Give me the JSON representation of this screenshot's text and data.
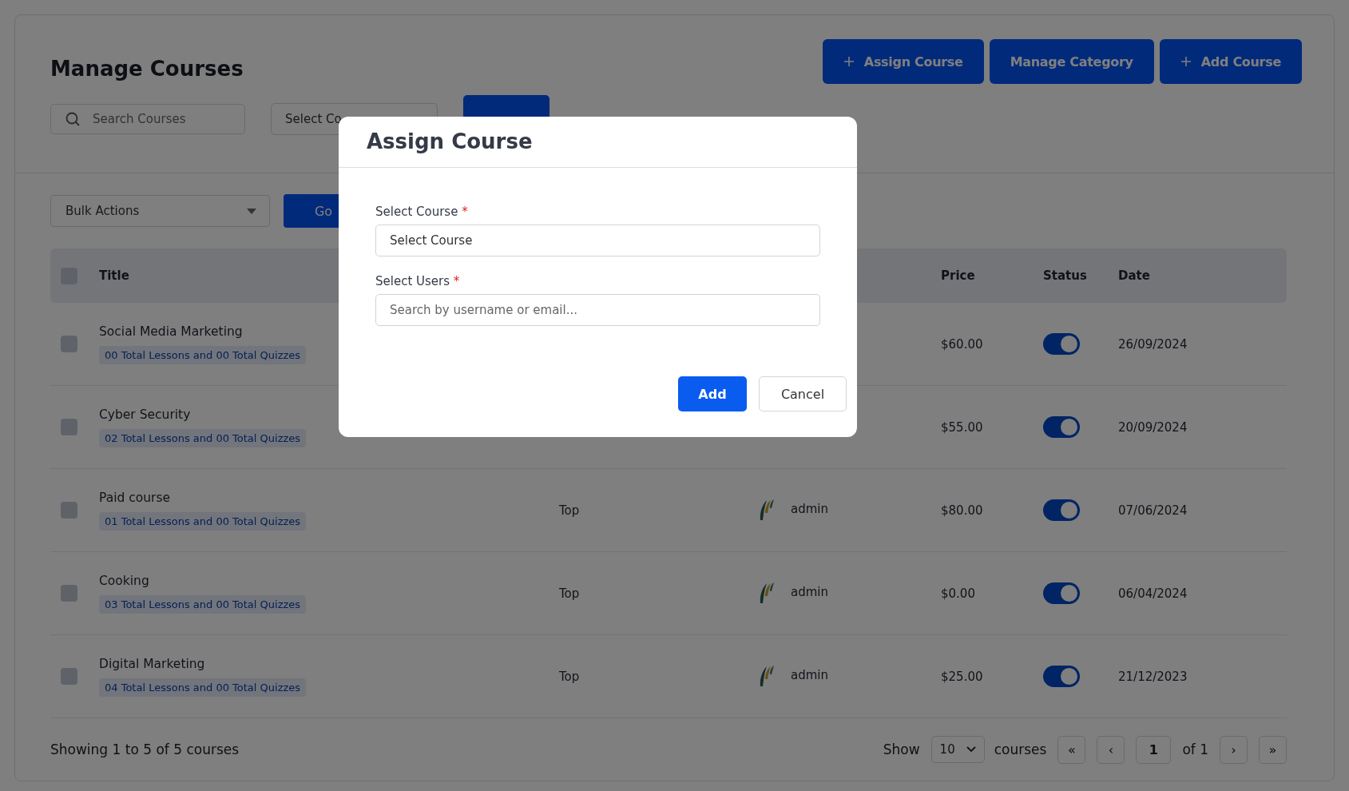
{
  "page": {
    "title": "Manage Courses",
    "actions": [
      {
        "label": "Assign Course",
        "kind": "add"
      },
      {
        "label": "Manage Category",
        "kind": "plain"
      },
      {
        "label": "Add Course",
        "kind": "add"
      }
    ],
    "filters": {
      "search": {
        "placeholder": "Search Courses"
      },
      "category_select": {
        "value": "Select Co"
      }
    },
    "bulk_actions": {
      "value": "Bulk Actions"
    },
    "go_button": "Go",
    "table": {
      "header_checkbox": {
        "checked": false
      },
      "columns": [
        {
          "label": "Title",
          "kind": "title"
        },
        {
          "label": "Price",
          "kind": "price"
        },
        {
          "label": "Status",
          "kind": "status"
        },
        {
          "label": "Date",
          "kind": "date"
        }
      ],
      "rows": [
        {
          "checked": false,
          "title": "Social Media Marketing",
          "summary": "00 Total Lessons and 00 Total Quizzes",
          "price": "$60.00",
          "on": true,
          "date": "26/09/2024"
        },
        {
          "checked": false,
          "title": "Cyber Security",
          "summary": "02 Total Lessons and 00 Total Quizzes",
          "price": "$55.00",
          "on": true,
          "date": "20/09/2024"
        },
        {
          "checked": false,
          "title": "Paid course",
          "summary": "01 Total Lessons and 00 Total Quizzes",
          "category": "Top",
          "author": "admin",
          "price": "$80.00",
          "on": true,
          "date": "07/06/2024"
        },
        {
          "checked": false,
          "title": "Cooking",
          "summary": "03 Total Lessons and 00 Total Quizzes",
          "category": "Top",
          "author": "admin",
          "price": "$0.00",
          "on": true,
          "date": "06/04/2024"
        },
        {
          "checked": false,
          "title": "Digital Marketing",
          "summary": "04 Total Lessons and 00 Total Quizzes",
          "category": "Top",
          "author": "admin",
          "price": "$25.00",
          "on": true,
          "date": "21/12/2023"
        }
      ]
    },
    "footer": {
      "summary": "Showing 1 to 5 of 5 courses",
      "show_label": "Show",
      "page_size": "10",
      "size_unit": "courses",
      "pagination": {
        "first": "«",
        "prev": "‹",
        "page": "1",
        "of": "of 1",
        "next": "›",
        "last": "»"
      }
    }
  },
  "modal": {
    "title": "Assign Course",
    "fields": [
      {
        "label": "Select Course",
        "required_mark": "*",
        "kind": "select",
        "value": "Select Course"
      },
      {
        "label": "Select Users",
        "required_mark": "*",
        "kind": "search",
        "placeholder": "Search by username or email..."
      }
    ],
    "buttons": [
      {
        "label": "Add",
        "kind": "primary"
      },
      {
        "label": "Cancel",
        "kind": "secondary"
      }
    ]
  }
}
